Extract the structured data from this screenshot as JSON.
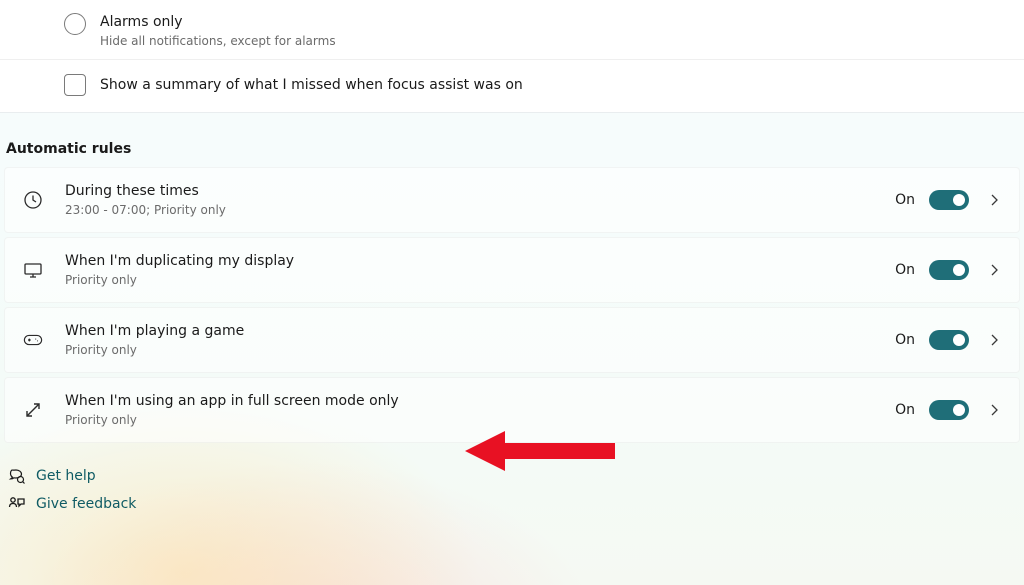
{
  "top_options": {
    "alarms_only": {
      "title": "Alarms only",
      "sub": "Hide all notifications, except for alarms"
    },
    "summary": {
      "label": "Show a summary of what I missed when focus assist was on"
    }
  },
  "section_title": "Automatic rules",
  "rules": [
    {
      "title": "During these times",
      "sub": "23:00 - 07:00; Priority only",
      "state": "On"
    },
    {
      "title": "When I'm duplicating my display",
      "sub": "Priority only",
      "state": "On"
    },
    {
      "title": "When I'm playing a game",
      "sub": "Priority only",
      "state": "On"
    },
    {
      "title": "When I'm using an app in full screen mode only",
      "sub": "Priority only",
      "state": "On"
    }
  ],
  "footer": {
    "help": "Get help",
    "feedback": "Give feedback"
  }
}
